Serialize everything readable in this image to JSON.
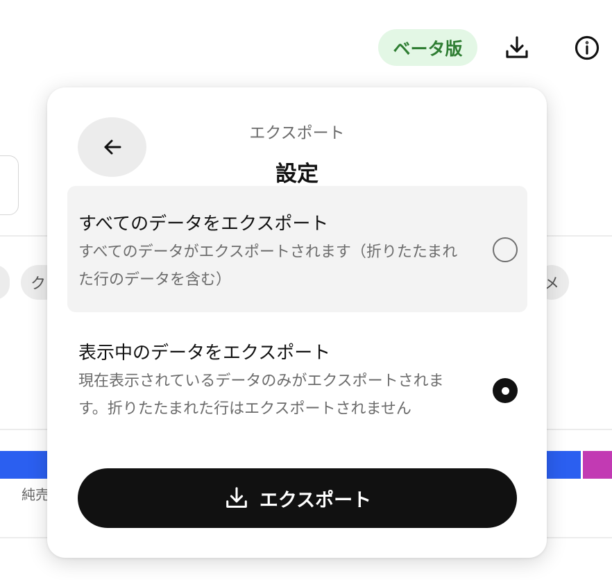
{
  "header": {
    "beta_badge": "ベータ版",
    "beta_bg": "#e3f7e5",
    "beta_color": "#2e7d32",
    "download_icon": "download-icon",
    "info_icon": "info-icon"
  },
  "background": {
    "chip_left_text": "ク",
    "chip_right_text": "メ",
    "bar_colors": [
      "#2b5ff0",
      "#c23ab3"
    ],
    "caption": "純売"
  },
  "export_popover": {
    "back_icon": "arrow-left-icon",
    "subtitle": "エクスポート",
    "title": "設定",
    "options": [
      {
        "title": "すべてのデータをエクスポート",
        "description": "すべてのデータがエクスポートされます（折りたたまれた行のデータを含む）",
        "selected": false
      },
      {
        "title": "表示中のデータをエクスポート",
        "description": "現在表示されているデータのみがエクスポートされます。折りたたまれた行はエクスポートされません",
        "selected": true
      }
    ],
    "export_button": "エクスポート"
  }
}
